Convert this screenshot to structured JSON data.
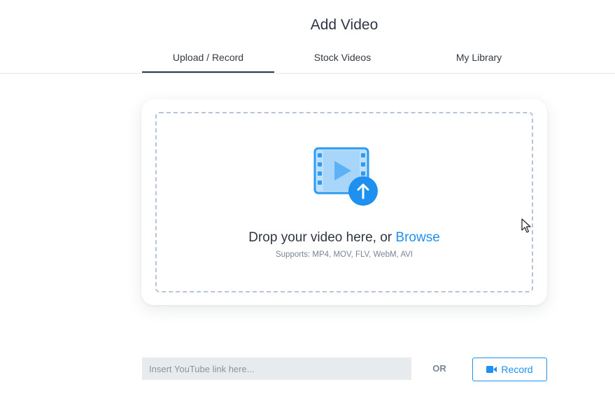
{
  "dialog": {
    "title": "Add Video"
  },
  "tabs": [
    {
      "label": "Upload / Record",
      "active": true
    },
    {
      "label": "Stock Videos",
      "active": false
    },
    {
      "label": "My Library",
      "active": false
    }
  ],
  "dropzone": {
    "icon": "video-upload-icon",
    "prompt": "Drop your video here, or ",
    "browse_label": "Browse",
    "supports": "Supports: MP4, MOV, FLV, WebM, AVI"
  },
  "youtube": {
    "placeholder": "Insert YouTube link here...",
    "value": ""
  },
  "separator": "OR",
  "record": {
    "icon": "video-camera-icon",
    "label": "Record"
  },
  "colors": {
    "accent": "#1e90f0",
    "text": "#2f3542",
    "muted": "#7a8594",
    "dashed_border": "#b7c4d6"
  }
}
